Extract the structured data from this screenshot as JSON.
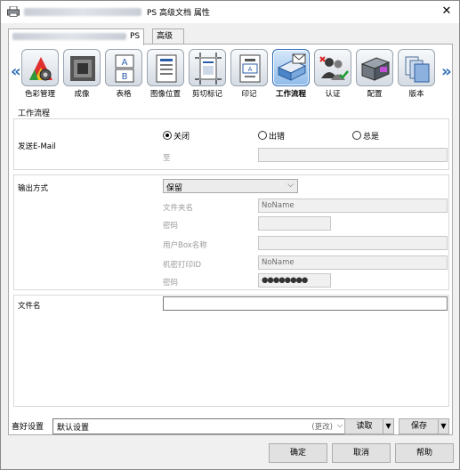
{
  "titlebar": {
    "title": "PS 高级文档 属性",
    "close": "✕"
  },
  "tabs": [
    {
      "label": "PS"
    },
    {
      "label": "高级"
    }
  ],
  "icon_strip": {
    "prev": "«",
    "next": "»",
    "items": [
      {
        "label": "色彩管理",
        "icon": "color-management-icon"
      },
      {
        "label": "成像",
        "icon": "imaging-icon"
      },
      {
        "label": "表格",
        "icon": "table-icon"
      },
      {
        "label": "图像位置",
        "icon": "image-position-icon"
      },
      {
        "label": "剪切标记",
        "icon": "crop-marks-icon"
      },
      {
        "label": "印记",
        "icon": "stamp-icon"
      },
      {
        "label": "工作流程",
        "icon": "workflow-icon"
      },
      {
        "label": "认证",
        "icon": "authentication-icon"
      },
      {
        "label": "配置",
        "icon": "configuration-icon"
      },
      {
        "label": "版本",
        "icon": "version-icon"
      }
    ],
    "selected": "工作流程"
  },
  "section_title": "工作流程",
  "email": {
    "label": "发送E-Mail",
    "options": [
      {
        "label": "关闭",
        "checked": true
      },
      {
        "label": "出错",
        "checked": false
      },
      {
        "label": "总是",
        "checked": false
      }
    ],
    "to_label": "至",
    "to_value": ""
  },
  "output": {
    "label": "输出方式",
    "selected": "保留",
    "folder_label": "文件夹名",
    "folder_value": "NoName",
    "password1_label": "密码",
    "password1_value": "",
    "userbox_label": "用户Box名称",
    "userbox_value": "",
    "secure_id_label": "机密打印ID",
    "secure_id_value": "NoName",
    "password2_label": "密码",
    "password2_value": "●●●●●●●●"
  },
  "filename": {
    "label": "文件名",
    "value": ""
  },
  "preferences": {
    "label": "喜好设置",
    "selected": "默认设置",
    "change": "(更改)",
    "load": "读取",
    "save": "保存"
  },
  "buttons": {
    "ok": "确定",
    "cancel": "取消",
    "help": "帮助"
  }
}
